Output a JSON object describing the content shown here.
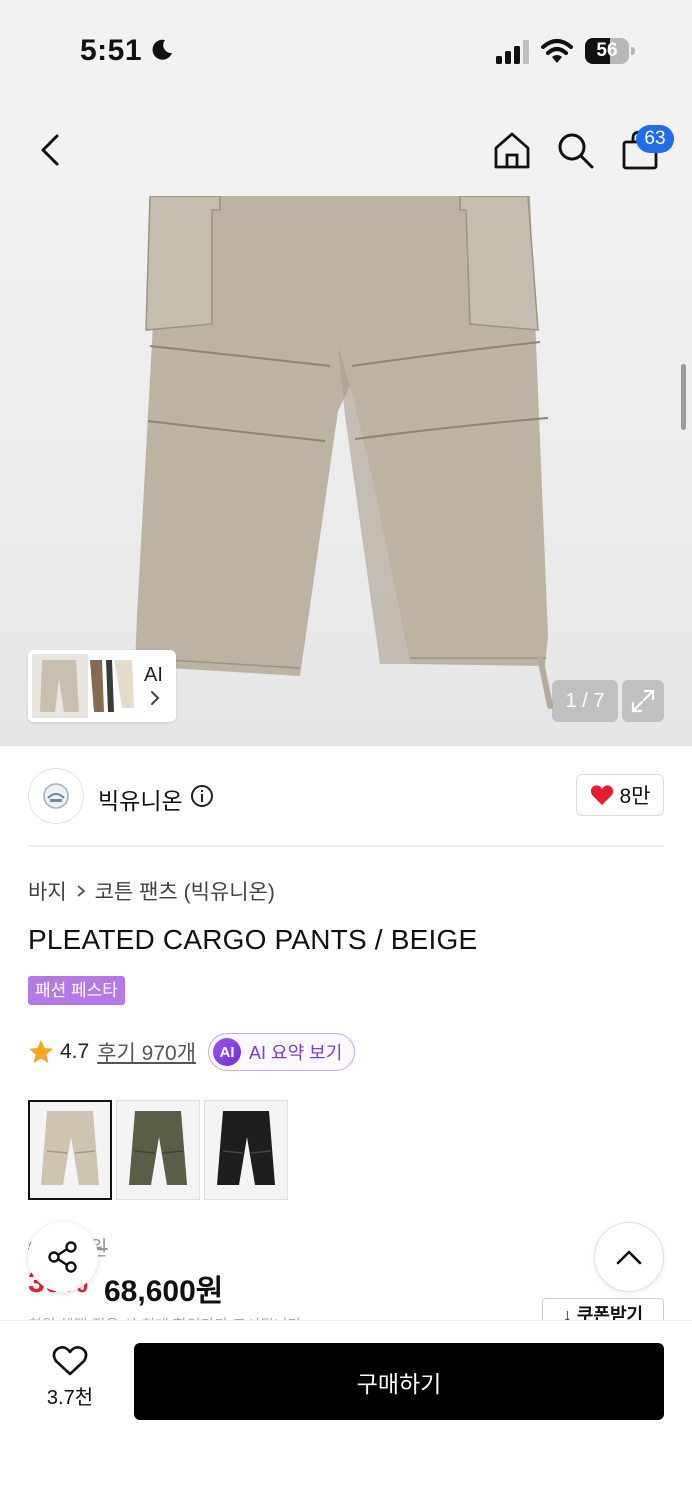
{
  "status_bar": {
    "time": "5:51",
    "battery_level": "56",
    "battery_fraction": 0.56,
    "icons": [
      "moon-icon",
      "signal-icon",
      "wifi-icon",
      "battery-icon"
    ]
  },
  "top_nav": {
    "icons": [
      "back-icon",
      "home-icon",
      "search-icon",
      "cart-icon"
    ],
    "cart_count": "63",
    "accent_color": "#1e6cf2"
  },
  "gallery": {
    "thumb_strip_label": "AI",
    "counter": "1 / 7",
    "icons": [
      "chevron-right-icon",
      "expand-icon"
    ]
  },
  "brand": {
    "name": "빅유니온",
    "like_count": "8만",
    "icons": [
      "brand-logo-icon",
      "info-icon",
      "heart-filled-icon"
    ]
  },
  "product": {
    "breadcrumb": [
      "바지",
      "코튼 팬츠 (빅유니온)"
    ],
    "title": "PLEATED CARGO PANTS / BEIGE",
    "tag": "패션 페스타",
    "tag_color": "#b678e6",
    "rating": "4.7",
    "reviews": "후기 970개",
    "ai_badge": "AI",
    "ai_summary": "AI 요약 보기",
    "swatch_colors": [
      "#cfc4b2",
      "#5a5e46",
      "#1e1e1e"
    ]
  },
  "price": {
    "original": "98,000원",
    "discount": "30%",
    "sale": "68,600원",
    "discount_color": "#e8202f",
    "coupon": "↓ 쿠폰받기",
    "fine_print": "회원 혜택 적용 시 최대 할인가가 표시됩니다"
  },
  "bottom_bar": {
    "wish_count": "3.7천",
    "buy_label": "구매하기"
  }
}
